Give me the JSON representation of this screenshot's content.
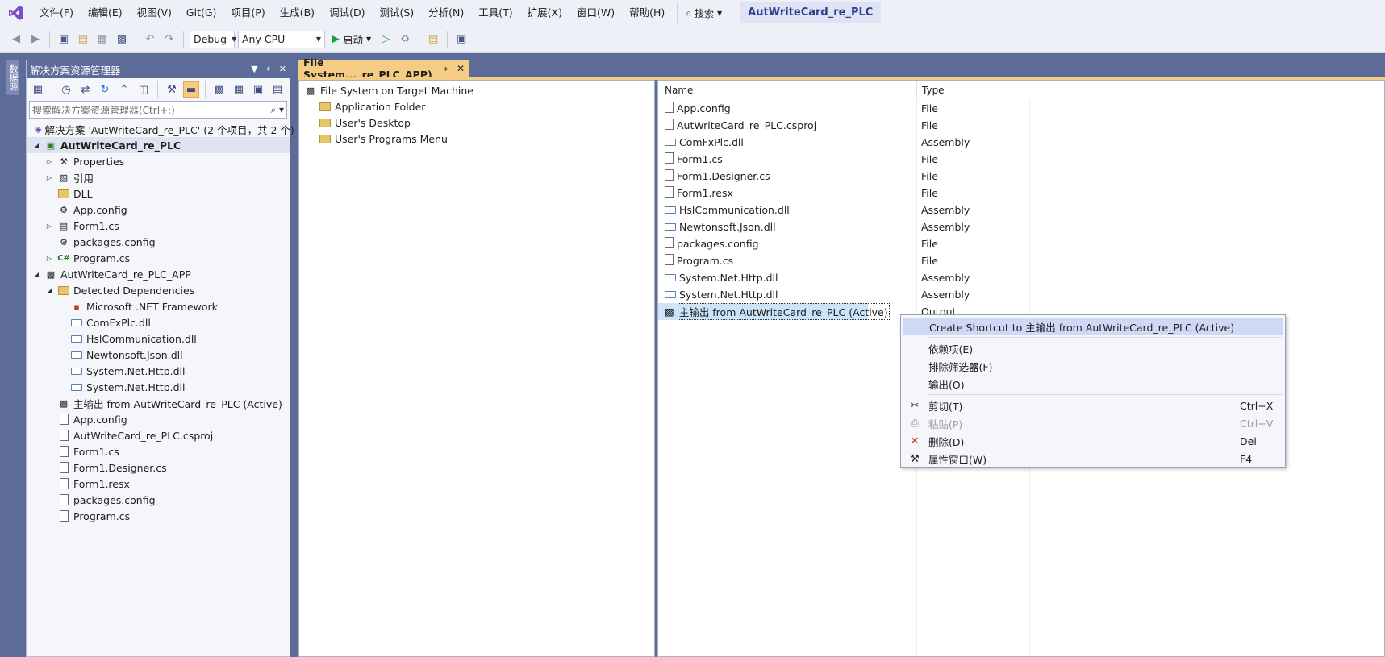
{
  "menubar": {
    "items": [
      "文件(F)",
      "编辑(E)",
      "视图(V)",
      "Git(G)",
      "项目(P)",
      "生成(B)",
      "调试(D)",
      "测试(S)",
      "分析(N)",
      "工具(T)",
      "扩展(X)",
      "窗口(W)",
      "帮助(H)"
    ],
    "search_label": "搜索",
    "solution_title": "AutWriteCard_re_PLC"
  },
  "toolbar": {
    "config": "Debug",
    "platform": "Any CPU",
    "start_label": "启动"
  },
  "side_strip": {
    "tab_label": "数据源"
  },
  "solution_explorer": {
    "title": "解决方案资源管理器",
    "search_placeholder": "搜索解决方案资源管理器(Ctrl+;)",
    "tree": [
      {
        "label": "解决方案 'AutWriteCard_re_PLC' (2 个项目，共 2 个)"
      },
      {
        "label": "AutWriteCard_re_PLC"
      },
      {
        "label": "Properties"
      },
      {
        "label": "引用"
      },
      {
        "label": "DLL"
      },
      {
        "label": "App.config"
      },
      {
        "label": "Form1.cs"
      },
      {
        "label": "packages.config"
      },
      {
        "label": "Program.cs"
      },
      {
        "label": "AutWriteCard_re_PLC_APP"
      },
      {
        "label": "Detected Dependencies"
      },
      {
        "label": "Microsoft .NET Framework"
      },
      {
        "label": "ComFxPlc.dll"
      },
      {
        "label": "HslCommunication.dll"
      },
      {
        "label": "Newtonsoft.Json.dll"
      },
      {
        "label": "System.Net.Http.dll"
      },
      {
        "label": "System.Net.Http.dll"
      },
      {
        "label": "主输出 from AutWriteCard_re_PLC (Active)"
      },
      {
        "label": "App.config"
      },
      {
        "label": "AutWriteCard_re_PLC.csproj"
      },
      {
        "label": "Form1.cs"
      },
      {
        "label": "Form1.Designer.cs"
      },
      {
        "label": "Form1.resx"
      },
      {
        "label": "packages.config"
      },
      {
        "label": "Program.cs"
      }
    ]
  },
  "doc_tab": {
    "title": "File System..._re_PLC_APP)"
  },
  "fs_tree": {
    "root": "File System on Target Machine",
    "folders": [
      "Application Folder",
      "User's Desktop",
      "User's Programs Menu"
    ]
  },
  "fs_list": {
    "headers": {
      "name": "Name",
      "type": "Type"
    },
    "rows": [
      {
        "name": "App.config",
        "type": "File"
      },
      {
        "name": "AutWriteCard_re_PLC.csproj",
        "type": "File"
      },
      {
        "name": "ComFxPlc.dll",
        "type": "Assembly"
      },
      {
        "name": "Form1.cs",
        "type": "File"
      },
      {
        "name": "Form1.Designer.cs",
        "type": "File"
      },
      {
        "name": "Form1.resx",
        "type": "File"
      },
      {
        "name": "HslCommunication.dll",
        "type": "Assembly"
      },
      {
        "name": "Newtonsoft.Json.dll",
        "type": "Assembly"
      },
      {
        "name": "packages.config",
        "type": "File"
      },
      {
        "name": "Program.cs",
        "type": "File"
      },
      {
        "name": "System.Net.Http.dll",
        "type": "Assembly"
      },
      {
        "name": "System.Net.Http.dll",
        "type": "Assembly"
      },
      {
        "name": "主输出 from AutWriteCard_re_PLC (Active)",
        "type": "Output"
      }
    ]
  },
  "context_menu": {
    "items": {
      "create_shortcut": "Create Shortcut to 主输出 from AutWriteCard_re_PLC (Active)",
      "dependencies": "依赖项(E)",
      "exclude_filter": "排除筛选器(F)",
      "outputs": "输出(O)",
      "cut": "剪切(T)",
      "cut_shortcut": "Ctrl+X",
      "paste": "粘贴(P)",
      "paste_shortcut": "Ctrl+V",
      "delete": "删除(D)",
      "delete_shortcut": "Del",
      "properties": "属性窗口(W)",
      "properties_shortcut": "F4"
    }
  },
  "colors": {
    "accent": "#5d6b99",
    "tab_active": "#f5cc84",
    "selection": "#cce4f7",
    "menu_highlight": "#cfd8f5"
  }
}
